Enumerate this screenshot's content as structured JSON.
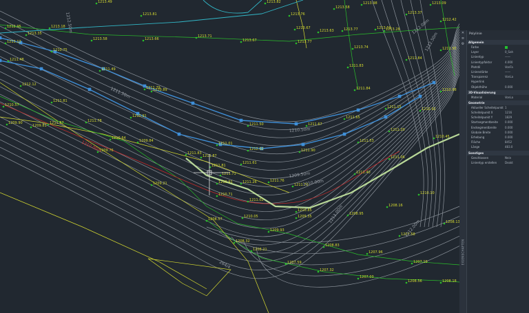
{
  "properties_panel": {
    "title": "Polylinie",
    "sections": [
      {
        "name": "Allgemein",
        "rows": [
          {
            "label": "Farbe",
            "value": ""
          },
          {
            "label": "Layer",
            "value": "0_Sah"
          },
          {
            "label": "Linientyp",
            "value": "——"
          },
          {
            "label": "Linientypfaktor",
            "value": "4.000"
          },
          {
            "label": "Plotstil",
            "value": "VonFa"
          },
          {
            "label": "Linienstärke",
            "value": "——"
          },
          {
            "label": "Transparenz",
            "value": "VonLa"
          },
          {
            "label": "Hyperlink",
            "value": ""
          },
          {
            "label": "Objekthöhe",
            "value": "0.000"
          }
        ]
      },
      {
        "name": "3D-Visualisierung",
        "rows": [
          {
            "label": "Material",
            "value": "VonLa"
          }
        ]
      },
      {
        "name": "Geometrie",
        "rows": [
          {
            "label": "Aktueller Scheitelpunkt",
            "value": "1"
          },
          {
            "label": "Scheitelpunkt X",
            "value": "1216"
          },
          {
            "label": "Scheitelpunkt Y",
            "value": "1829"
          },
          {
            "label": "Startsegmentbreite",
            "value": "0.000"
          },
          {
            "label": "Endsegmentbreite",
            "value": "0.000"
          },
          {
            "label": "Globale Breite",
            "value": "0.000"
          },
          {
            "label": "Erhebung",
            "value": "0.000"
          },
          {
            "label": "Fläche",
            "value": "8452"
          },
          {
            "label": "Länge",
            "value": "483.0"
          }
        ]
      },
      {
        "name": "Sonstiges",
        "rows": [
          {
            "label": "Geschlossen",
            "value": "Nein"
          },
          {
            "label": "Linientyp erstellen",
            "value": "Deakt"
          }
        ]
      }
    ],
    "side_title": "EIGENSCHAFTEN",
    "colors": {
      "layer_swatch": "#22c02e"
    }
  },
  "drawing": {
    "colors": {
      "background": "#212830",
      "contour": "#8c939b",
      "blue_polyline": "#3f8fd8",
      "selected_polyline": "#b8d898",
      "parcel": "#d8dc30",
      "green": "#2ac02a",
      "red_line": "#c42a2a",
      "cyan_line": "#32b8c8"
    },
    "point_labels": [
      "1213.49",
      "1213.81",
      "1213.82",
      "1213.76",
      "1213.58",
      "1213.98",
      "1213.59",
      "1213.09",
      "1212.95",
      "1213.18",
      "1213.35",
      "1213.58",
      "1213.66",
      "1213.71",
      "1213.67",
      "1213.77",
      "1213.67",
      "1213.63",
      "1213.77",
      "1213.28",
      "1212.42",
      "1213.12",
      "1213.74",
      "1213.37",
      "1211.95",
      "1211.48",
      "1210.75",
      "1211.83",
      "1211.84",
      "1211.49",
      "1211.79",
      "1212.12",
      "1210.98",
      "1211.84",
      "1210.57",
      "1211.57",
      "1210.91",
      "1211.81",
      "1209.90",
      "1209.81",
      "1211.78",
      "1210.64",
      "1210.89",
      "1211.67",
      "1211.65",
      "1211.50",
      "1211.15",
      "1211.20",
      "1211.01",
      "1212.02",
      "1211.90",
      "1211.53",
      "1210.92",
      "1210.45",
      "1209.76",
      "1209.84",
      "1211.83",
      "1211.87",
      "1211.61",
      "1211.81",
      "1211.71",
      "1211.26",
      "1211.40",
      "1211.06",
      "1210.91",
      "1211.76",
      "1211.70",
      "1210.71",
      "1211.02",
      "1209.21",
      "1210.85",
      "1210.10",
      "1208.16",
      "1208.95",
      "1209.35",
      "1210.05",
      "1209.93",
      "1208.57",
      "1207.58",
      "1208.32",
      "1208.21",
      "1208.83",
      "1207.96",
      "1207.19",
      "1207.59",
      "1207.32",
      "1207.03",
      "1208.56",
      "1208.18",
      "1205.49",
      "1208.13"
    ],
    "contour_labels": [
      "1212.50m",
      "1212.00m",
      "1211.50m",
      "1210.50m",
      "1209.50m",
      "1210.00m",
      "1213.00m",
      "1212.00m",
      "1212.50m"
    ],
    "red_label": "1210.00m",
    "parcel_id": "284/4"
  }
}
